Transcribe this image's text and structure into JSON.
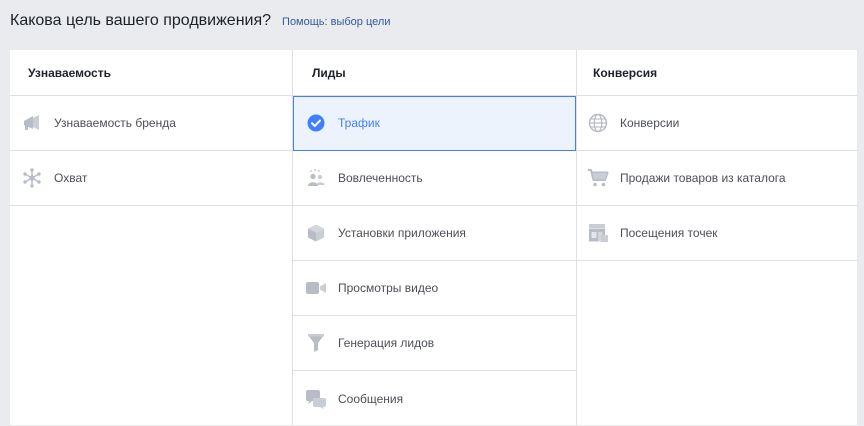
{
  "header": {
    "title": "Какова цель вашего продвижения?",
    "help_link": "Помощь: выбор цели"
  },
  "columns": [
    {
      "title": "Узнаваемость",
      "items": [
        {
          "label": "Узнаваемость бренда",
          "icon": "megaphone-icon"
        },
        {
          "label": "Охват",
          "icon": "reach-icon"
        }
      ]
    },
    {
      "title": "Лиды",
      "items": [
        {
          "label": "Трафик",
          "icon": "checkmark-circle-icon",
          "selected": true
        },
        {
          "label": "Вовлеченность",
          "icon": "people-icon"
        },
        {
          "label": "Установки приложения",
          "icon": "box-icon"
        },
        {
          "label": "Просмотры видео",
          "icon": "video-camera-icon"
        },
        {
          "label": "Генерация лидов",
          "icon": "funnel-icon"
        },
        {
          "label": "Сообщения",
          "icon": "chat-bubbles-icon"
        }
      ]
    },
    {
      "title": "Конверсия",
      "items": [
        {
          "label": "Конверсии",
          "icon": "globe-icon"
        },
        {
          "label": "Продажи товаров из каталога",
          "icon": "shopping-cart-icon"
        },
        {
          "label": "Посещения точек",
          "icon": "store-icon"
        }
      ]
    }
  ],
  "colors": {
    "background": "#e9ebee",
    "accent": "#4080ff",
    "selected_bg": "#ecf3fc",
    "link": "#365899",
    "icon_gray": "#b7bcc6"
  }
}
